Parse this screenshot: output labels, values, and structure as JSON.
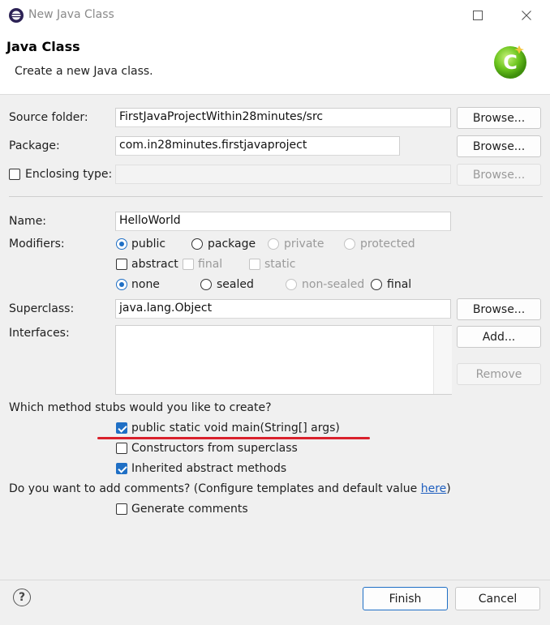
{
  "window": {
    "title": "New Java Class",
    "minimize_icon": "minimize-icon",
    "maximize_icon": "maximize-icon",
    "close_icon": "close-icon"
  },
  "header": {
    "title": "Java Class",
    "description": "Create a new Java class.",
    "icon": "new-java-class-wizard-icon"
  },
  "source_folder": {
    "label": "Source folder:",
    "value": "FirstJavaProjectWithin28minutes/src",
    "browse": "Browse..."
  },
  "package": {
    "label": "Package:",
    "value": "com.in28minutes.firstjavaproject",
    "browse": "Browse..."
  },
  "enclosing_type": {
    "label": "Enclosing type:",
    "checked": false,
    "value": "",
    "browse": "Browse..."
  },
  "name": {
    "label": "Name:",
    "value": "HelloWorld"
  },
  "modifiers": {
    "label": "Modifiers:",
    "access": {
      "public": "public",
      "package": "package",
      "private": "private",
      "protected": "protected",
      "selected": "public"
    },
    "abstract": "abstract",
    "final": "final",
    "static": "static",
    "inheritance": {
      "none": "none",
      "sealed": "sealed",
      "non_sealed": "non-sealed",
      "final": "final",
      "selected": "none"
    }
  },
  "superclass": {
    "label": "Superclass:",
    "value": "java.lang.Object",
    "browse": "Browse..."
  },
  "interfaces": {
    "label": "Interfaces:",
    "add": "Add...",
    "remove": "Remove",
    "items": []
  },
  "stubs": {
    "question": "Which method stubs would you like to create?",
    "main": {
      "label": "public static void main(String[] args)",
      "checked": true
    },
    "constructors": {
      "label": "Constructors from superclass",
      "checked": false
    },
    "inherited": {
      "label": "Inherited abstract methods",
      "checked": true
    }
  },
  "comments": {
    "question": "Do you want to add comments? (Configure templates and default value ",
    "link": "here",
    "question_end": ")",
    "generate": {
      "label": "Generate comments",
      "checked": false
    }
  },
  "footer": {
    "help_icon": "help-icon",
    "help_glyph": "?",
    "finish": "Finish",
    "cancel": "Cancel"
  },
  "colors": {
    "accent": "#1f6fc5",
    "annotation": "#d9212c",
    "link": "#1f5fbf"
  }
}
